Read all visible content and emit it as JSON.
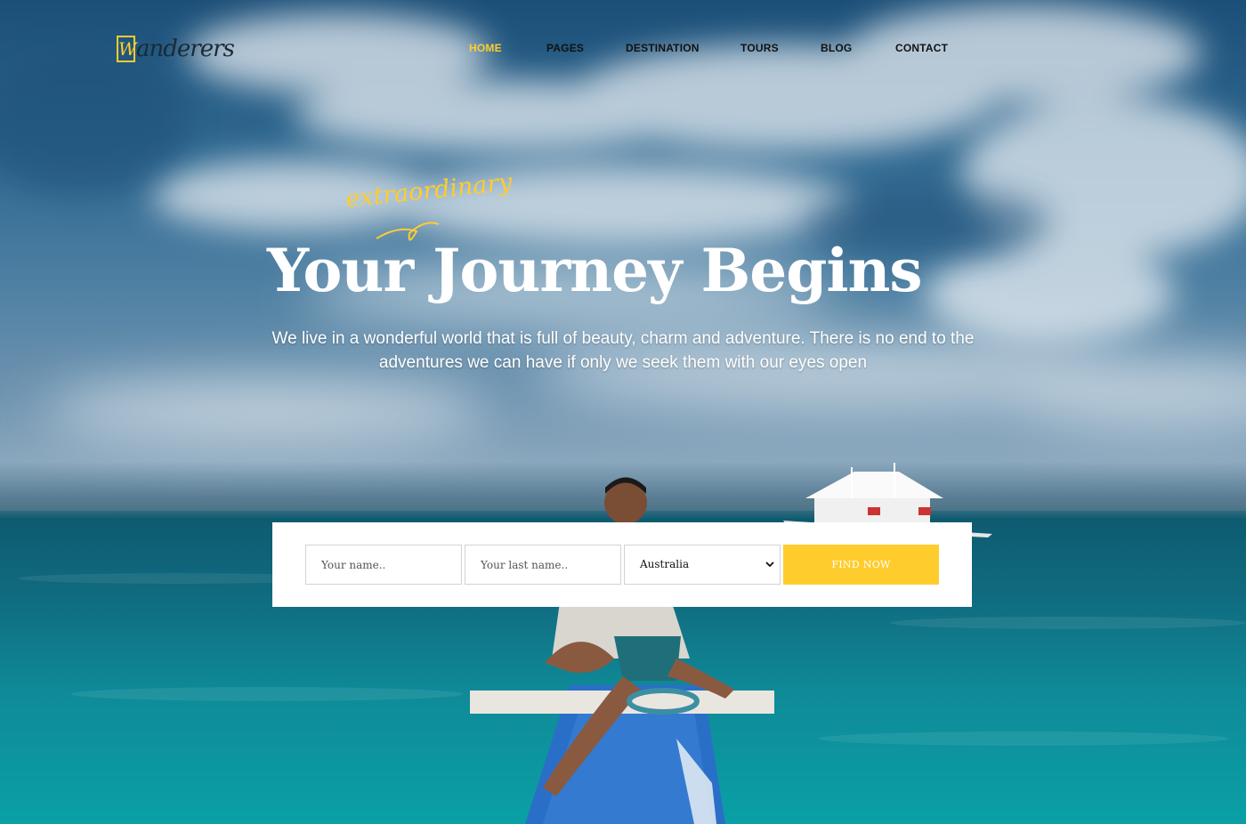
{
  "brand": {
    "mark": "W",
    "name": "anderers",
    "accent": "#ffcc2e"
  },
  "nav": {
    "items": [
      {
        "label": "HOME",
        "active": true
      },
      {
        "label": "PAGES",
        "active": false
      },
      {
        "label": "DESTINATION",
        "active": false
      },
      {
        "label": "TOURS",
        "active": false
      },
      {
        "label": "BLOG",
        "active": false
      },
      {
        "label": "CONTACT",
        "active": false
      }
    ]
  },
  "hero": {
    "accent_word": "extraordinary",
    "title": "Your Journey Begins",
    "subtitle": "We live in a wonderful world that is full of beauty, charm and adventure. There is no end to the adventures we can have if only we seek them with our eyes open"
  },
  "search": {
    "first_name_placeholder": "Your name..",
    "last_name_placeholder": "Your last name..",
    "country_selected": "Australia",
    "button_label": "FIND NOW",
    "button_color": "#ffcc2e"
  }
}
